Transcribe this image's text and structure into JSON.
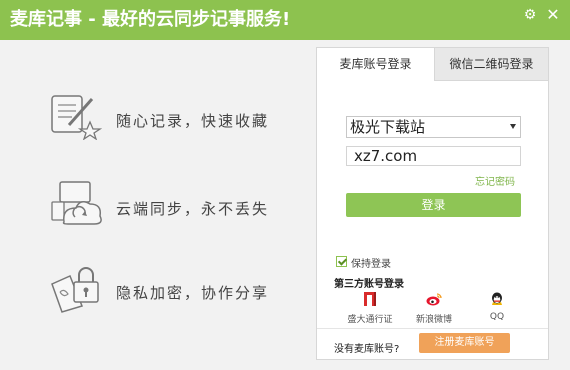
{
  "window": {
    "title": "麦库记事 - 最好的云同步记事服务!"
  },
  "features": [
    {
      "icon": "note-edit-icon",
      "text": "随心记录，快速收藏"
    },
    {
      "icon": "cloud-sync-icon",
      "text": "云端同步，永不丢失"
    },
    {
      "icon": "lock-share-icon",
      "text": "隐私加密，协作分享"
    }
  ],
  "login": {
    "tabs": [
      {
        "label": "麦库账号登录",
        "active": true
      },
      {
        "label": "微信二维码登录",
        "active": false
      }
    ],
    "account_value": "极光下载站",
    "password_value": "xz7.com",
    "forgot_label": "忘记密码",
    "login_label": "登录",
    "remember_label": "保持登录",
    "remember_checked": true,
    "third_party_title": "第三方账号登录",
    "third_party": [
      {
        "label": "盛大通行证",
        "icon": "shanda-icon"
      },
      {
        "label": "新浪微博",
        "icon": "weibo-icon"
      },
      {
        "label": "QQ",
        "icon": "qq-icon"
      }
    ],
    "no_account_label": "没有麦库账号?",
    "register_label": "注册麦库账号"
  },
  "colors": {
    "accent": "#8dc24f",
    "login_button": "#8ec555",
    "register_button": "#f0a259",
    "link": "#7fb54a"
  }
}
